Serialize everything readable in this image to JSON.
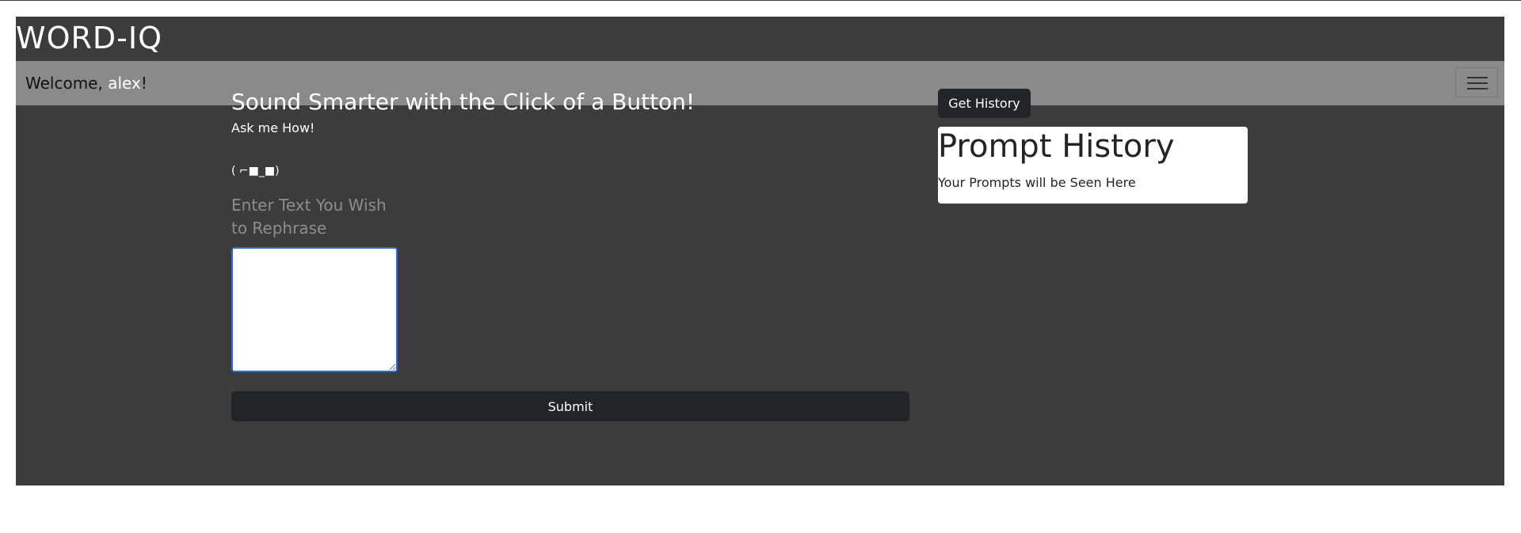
{
  "app": {
    "brand": "WORD-IQ"
  },
  "navbar": {
    "welcome_prefix": "Welcome, ",
    "username": "alex",
    "welcome_suffix": "!",
    "menu_icon": "hamburger-menu-icon"
  },
  "main": {
    "headline": "Sound Smarter with the Click of a Button!",
    "subline": "Ask me How!",
    "emoticon": "( ⌐■_■)",
    "input_label": "Enter Text You Wish to Rephrase",
    "textarea_value": "",
    "submit_label": "Submit"
  },
  "history": {
    "button_label": "Get History",
    "title": "Prompt History",
    "subtitle": "Your Prompts will be Seen Here"
  },
  "colors": {
    "app_background": "#3c3c3c",
    "navbar_background": "#8a8a8a",
    "button_dark": "#212529",
    "focus_border": "#2d6cdf"
  }
}
